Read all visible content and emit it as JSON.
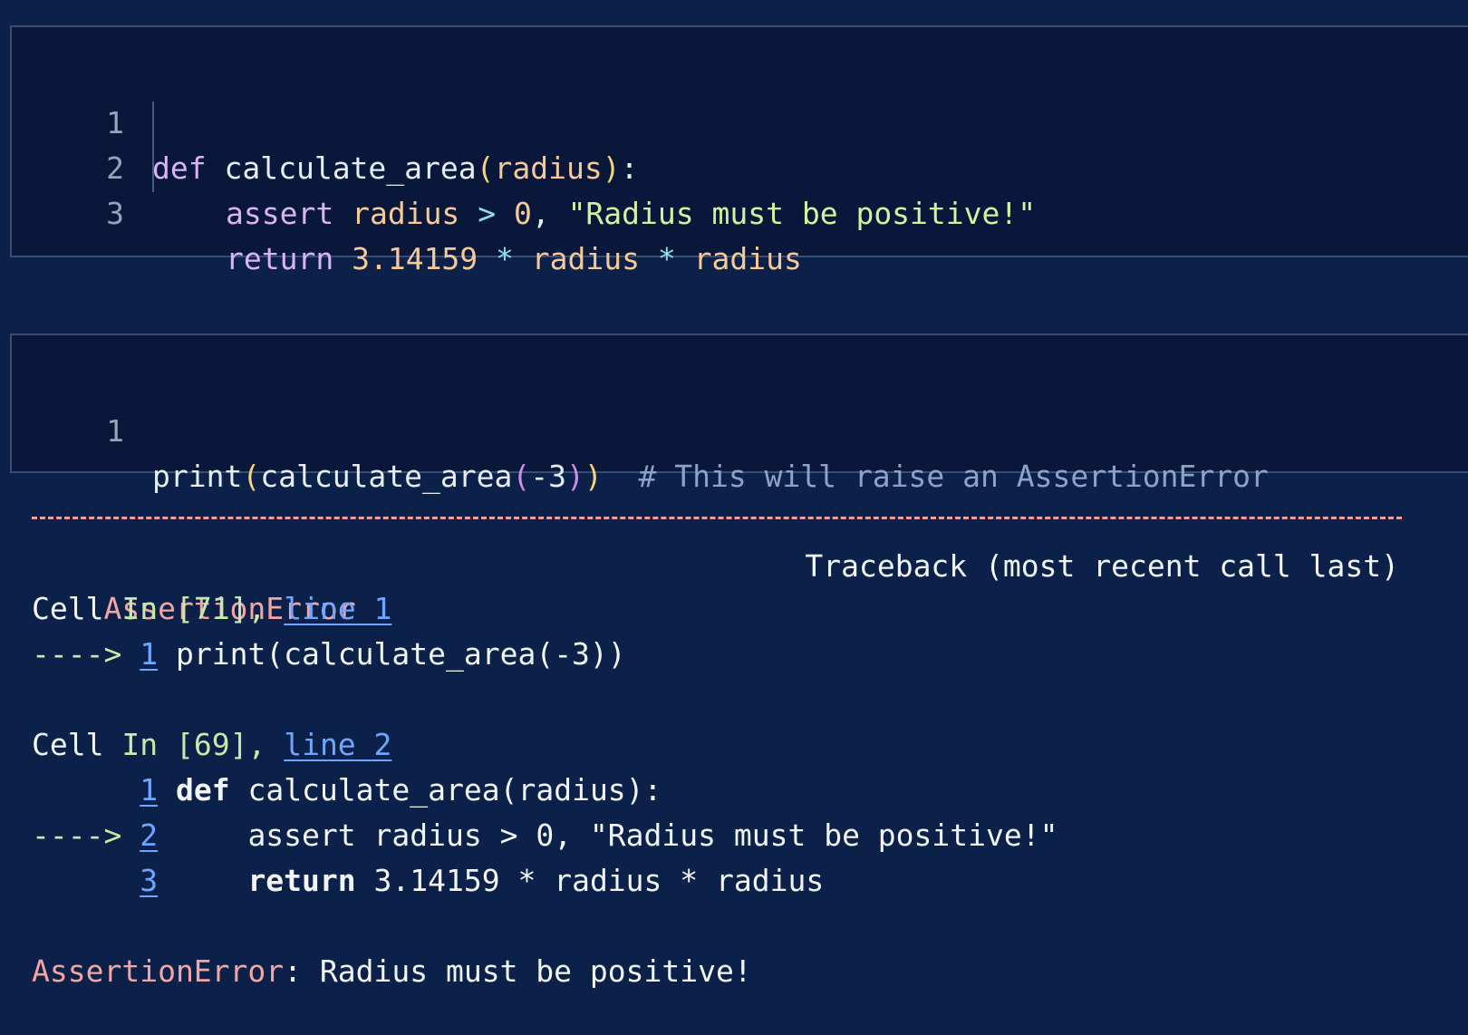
{
  "cell1": {
    "lines": [
      {
        "num": "1"
      },
      {
        "num": "2"
      },
      {
        "num": "3"
      }
    ],
    "tokens": {
      "def": "def",
      "fn_name": "calculate_area",
      "paren_open": "(",
      "param": "radius",
      "paren_close": ")",
      "colon": ":",
      "assert": "assert",
      "radius": "radius",
      "gt": ">",
      "zero": "0",
      "comma": ",",
      "message": "\"Radius must be positive!\"",
      "return": "return",
      "pi": "3.14159",
      "mul": "*"
    }
  },
  "cell2": {
    "line_num": "1",
    "tokens": {
      "print": "print",
      "paren_open": "(",
      "fn_name": "calculate_area",
      "paren2_open": "(",
      "arg": "-3",
      "paren2_close": ")",
      "paren_close": ")",
      "comment": "# This will raise an AssertionError"
    }
  },
  "traceback": {
    "error_name": "AssertionError",
    "header_right": "Traceback (most recent call last)",
    "frame1": {
      "cell_word": "Cell",
      "in_word": "In",
      "cell_ref": "[71],",
      "line_link": "line 1",
      "arrow": "---->",
      "arrow_num": "1",
      "code": "print(calculate_area(-3))"
    },
    "frame2": {
      "cell_word": "Cell",
      "in_word": "In",
      "cell_ref": "[69],",
      "line_link": "line 2",
      "line1_num": "1",
      "line1_kw": "def",
      "line1_code": "calculate_area(radius):",
      "arrow": "---->",
      "line2_num": "2",
      "line2_code": "    assert radius > 0, \"Radius must be positive!\"",
      "line3_num": "3",
      "line3_kw": "return",
      "line3_code": "3.14159 * radius * radius"
    },
    "final_error_name": "AssertionError",
    "final_message": ": Radius must be positive!"
  },
  "colors": {
    "background": "#0c2149",
    "cell_background": "#08173a",
    "error": "#f2a5a5",
    "link": "#6ea6ff",
    "arrow": "#c7e9a9"
  }
}
